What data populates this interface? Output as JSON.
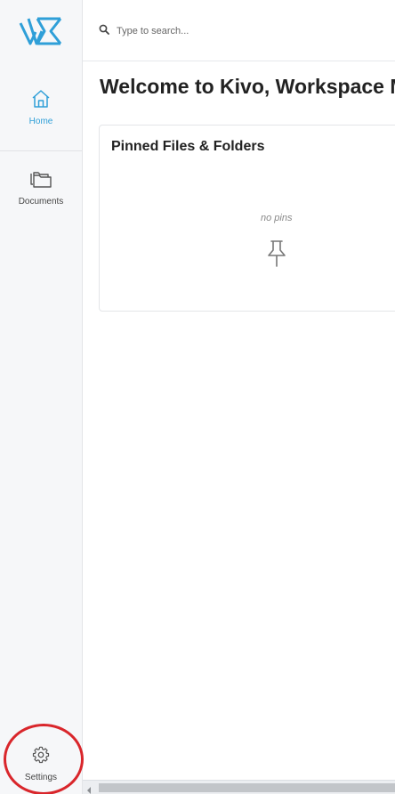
{
  "app": {
    "name": "Kivo"
  },
  "sidebar": {
    "items": [
      {
        "label": "Home",
        "icon": "home-icon",
        "active": true
      },
      {
        "label": "Documents",
        "icon": "folders-icon",
        "active": false
      }
    ],
    "settings_label": "Settings"
  },
  "search": {
    "placeholder": "Type to search..."
  },
  "main": {
    "title": "Welcome to Kivo, Workspace M",
    "pinned_card": {
      "title": "Pinned Files & Folders",
      "empty_text": "no pins"
    }
  },
  "colors": {
    "accent": "#2f9fd8",
    "annotation": "#d9262b",
    "sidebar_bg": "#f6f7f9"
  }
}
